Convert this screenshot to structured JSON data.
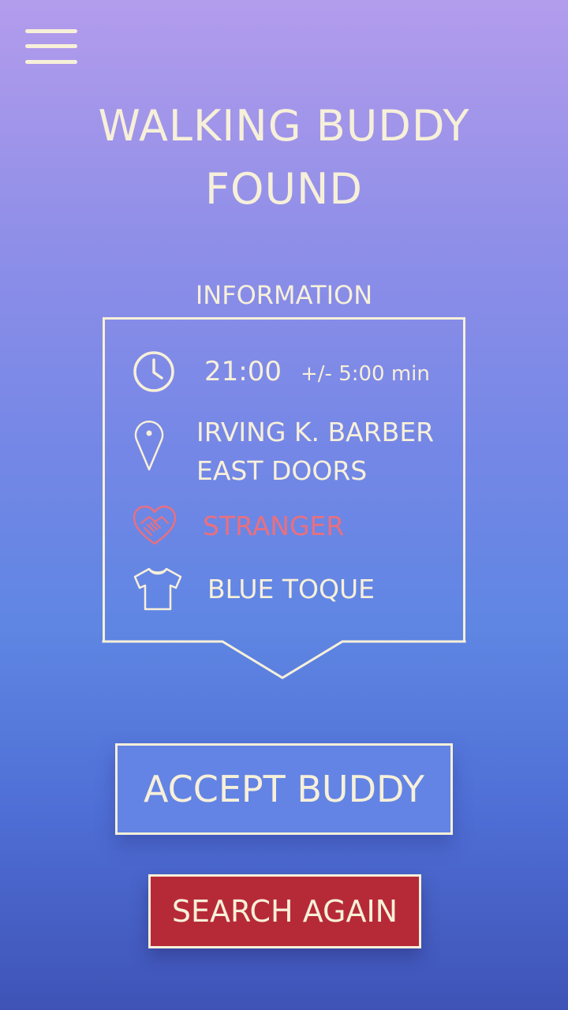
{
  "header": {
    "menu_icon": "hamburger-menu-icon",
    "title_line1": "WALKING BUDDY",
    "title_line2": "FOUND"
  },
  "information": {
    "label": "INFORMATION",
    "time": {
      "icon": "clock-icon",
      "value": "21:00",
      "tolerance": "+/- 5:00 min"
    },
    "location": {
      "icon": "map-pin-icon",
      "line1": "IRVING K. BARBER",
      "line2": "EAST DOORS"
    },
    "relation": {
      "icon": "heart-handshake-icon",
      "value": "STRANGER"
    },
    "clothing": {
      "icon": "t-shirt-icon",
      "value": "BLUE TOQUE"
    }
  },
  "actions": {
    "accept_label": "ACCEPT BUDDY",
    "search_again_label": "SEARCH AGAIN"
  },
  "colors": {
    "text": "#f7f0d9",
    "stranger": "#e8707f",
    "accept_button": "#6384e4",
    "search_button": "#b62a38",
    "gradient_top": "#b39cec",
    "gradient_bottom": "#3f53b6"
  }
}
